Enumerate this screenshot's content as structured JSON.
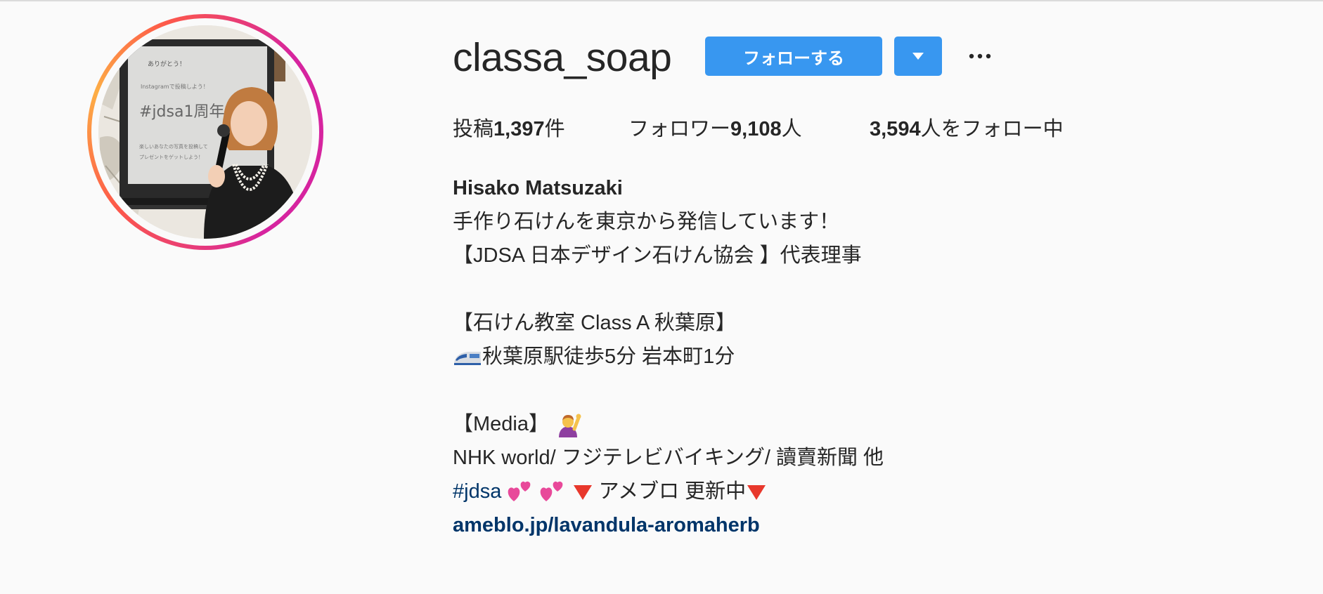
{
  "profile": {
    "username": "classa_soap",
    "follow_label": "フォローする",
    "stats": {
      "posts_prefix": "投稿",
      "posts_count": "1,397",
      "posts_suffix": "件",
      "followers_prefix": "フォロワー",
      "followers_count": "9,108",
      "followers_suffix": "人",
      "following_count": "3,594",
      "following_suffix": "人をフォロー中"
    },
    "full_name": "Hisako Matsuzaki",
    "bio": {
      "line1": "手作り石けんを東京から発信しています！",
      "line2": "【JDSA 日本デザイン石けん協会 】代表理事",
      "line3": "【石けん教室 Class A 秋葉原】",
      "line4": "秋葉原駅徒歩5分 岩本町1分",
      "line5": "【Media】",
      "line6": "NHK world/ フジテレビバイキング/ 讀賣新聞 他",
      "hashtag": "#jdsa",
      "line7_text": "アメブロ 更新中",
      "link": "ameblo.jp/lavandula-aromaherb"
    },
    "avatar_screen": {
      "line_a": "ありがとう！",
      "line_b": "Instagramで投稿しよう！",
      "hashtag": "#jdsa1周年",
      "line_c": "楽しいあなたの写真を投稿して",
      "line_d": "プレゼントをゲットしよう！"
    }
  },
  "icons": {
    "dropdown": "caret-down-icon",
    "more": "more-horizontal-icon",
    "train": "train-emoji",
    "person": "person-raising-hand-emoji",
    "hearts": "two-hearts-emoji",
    "triangle": "red-triangle-down-emoji"
  },
  "colors": {
    "primary_button": "#3897f0",
    "link": "#003569",
    "text": "#262626",
    "background": "#fafafa"
  }
}
